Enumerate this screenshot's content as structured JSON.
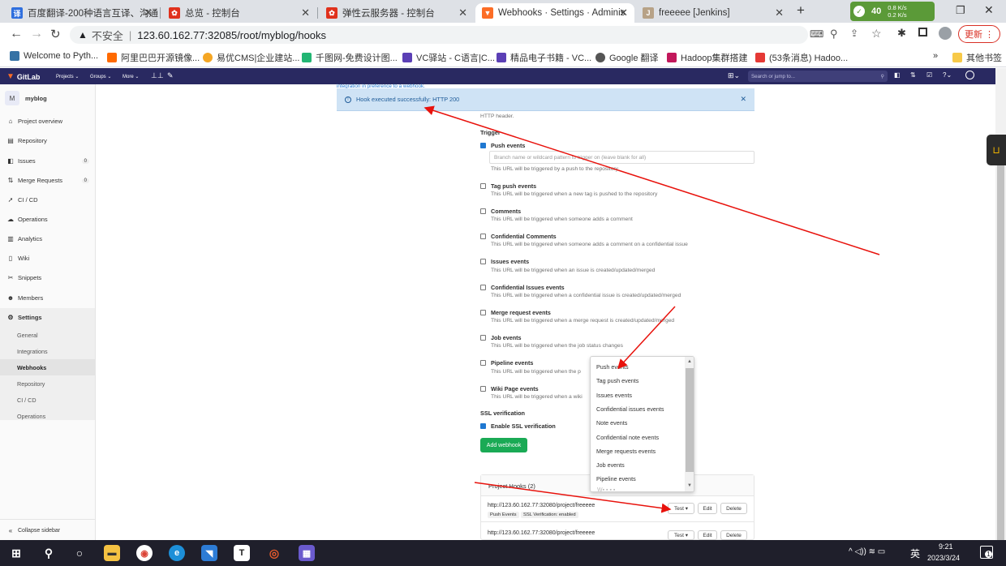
{
  "browser": {
    "tabs": [
      {
        "title": "百度翻译-200种语言互译、沟通",
        "icon": "baidu-translate-icon"
      },
      {
        "title": "总览 - 控制台",
        "icon": "huawei-icon"
      },
      {
        "title": "弹性云服务器 - 控制台",
        "icon": "huawei-icon"
      },
      {
        "title": "Webhooks · Settings · Adminis",
        "icon": "gitlab-icon"
      },
      {
        "title": "freeeee [Jenkins]",
        "icon": "jenkins-icon"
      }
    ],
    "net_badge": "40",
    "net_up": "0.8 K/s",
    "net_down": "0.2 K/s",
    "security": "不安全",
    "url": "123.60.162.77:32085/root/myblog/hooks",
    "update_label": "更新",
    "bookmarks": [
      "Welcome to Pyth...",
      "阿里巴巴开源镜像...",
      "易优CMS|企业建站...",
      "千图网-免费设计图...",
      "VC驿站 - C语言|C...",
      "精品电子书籍 - VC...",
      "Google 翻译",
      "Hadoop集群搭建",
      "(53条消息) Hadoo..."
    ],
    "other_bookmarks": "其他书签"
  },
  "gitlab": {
    "logo": "GitLab",
    "nav": [
      "Projects ⌄",
      "Groups ⌄",
      "More ⌄"
    ],
    "search_placeholder": "Search or jump to...",
    "project_letter": "M",
    "project_name": "myblog",
    "sidebar": [
      {
        "label": "Project overview",
        "icon": "home-icon"
      },
      {
        "label": "Repository",
        "icon": "book-icon"
      },
      {
        "label": "Issues",
        "icon": "issues-icon",
        "count": "0"
      },
      {
        "label": "Merge Requests",
        "icon": "merge-icon",
        "count": "0"
      },
      {
        "label": "CI / CD",
        "icon": "rocket-icon"
      },
      {
        "label": "Operations",
        "icon": "cloud-icon"
      },
      {
        "label": "Analytics",
        "icon": "chart-icon"
      },
      {
        "label": "Wiki",
        "icon": "wiki-icon"
      },
      {
        "label": "Snippets",
        "icon": "scissors-icon"
      },
      {
        "label": "Members",
        "icon": "users-icon"
      },
      {
        "label": "Settings",
        "icon": "gear-icon"
      }
    ],
    "settings_sub": [
      "General",
      "Integrations",
      "Webhooks",
      "Repository",
      "CI / CD",
      "Operations"
    ],
    "collapse": "Collapse sidebar"
  },
  "main": {
    "top_partial": "integration in preference to a webhook.",
    "flash": "Hook executed successfully: HTTP 200",
    "http_header": "HTTP header.",
    "trigger": "Trigger",
    "branch_placeholder": "Branch name or wildcard pattern to trigger on (leave blank for all)",
    "events": [
      {
        "name": "Push events",
        "desc": "This URL will be triggered by a push to the repository",
        "checked": true
      },
      {
        "name": "Tag push events",
        "desc": "This URL will be triggered when a new tag is pushed to the repository",
        "checked": false
      },
      {
        "name": "Comments",
        "desc": "This URL will be triggered when someone adds a comment",
        "checked": false
      },
      {
        "name": "Confidential Comments",
        "desc": "This URL will be triggered when someone adds a comment on a confidential issue",
        "checked": false
      },
      {
        "name": "Issues events",
        "desc": "This URL will be triggered when an issue is created/updated/merged",
        "checked": false
      },
      {
        "name": "Confidential Issues events",
        "desc": "This URL will be triggered when a confidential issue is created/updated/merged",
        "checked": false
      },
      {
        "name": "Merge request events",
        "desc": "This URL will be triggered when a merge request is created/updated/merged",
        "checked": false
      },
      {
        "name": "Job events",
        "desc": "This URL will be triggered when the job status changes",
        "checked": false
      },
      {
        "name": "Pipeline events",
        "desc": "This URL will be triggered when the p",
        "checked": false
      },
      {
        "name": "Wiki Page events",
        "desc": "This URL will be triggered when a wiki",
        "checked": false
      }
    ],
    "ssl_title": "SSL verification",
    "ssl_label": "Enable SSL verification",
    "add_webhook": "Add webhook",
    "project_hooks": "Project Hooks (2)",
    "hooks": [
      {
        "url": "http://123.60.162.77:32080/project/freeeee",
        "tags": [
          "Push Events",
          "SSL Verification: enabled"
        ]
      },
      {
        "url": "http://123.60.162.77:32080/project/freeeee",
        "tags": []
      }
    ],
    "test_label": "Test ▾",
    "edit_label": "Edit",
    "delete_label": "Delete",
    "dropdown": [
      "Push events",
      "Tag push events",
      "Issues events",
      "Confidential issues events",
      "Note events",
      "Confidential note events",
      "Merge requests events",
      "Job events",
      "Pipeline events"
    ]
  },
  "taskbar": {
    "lang": "英",
    "time": "9:21",
    "date": "2023/3/24",
    "notif": "1"
  }
}
